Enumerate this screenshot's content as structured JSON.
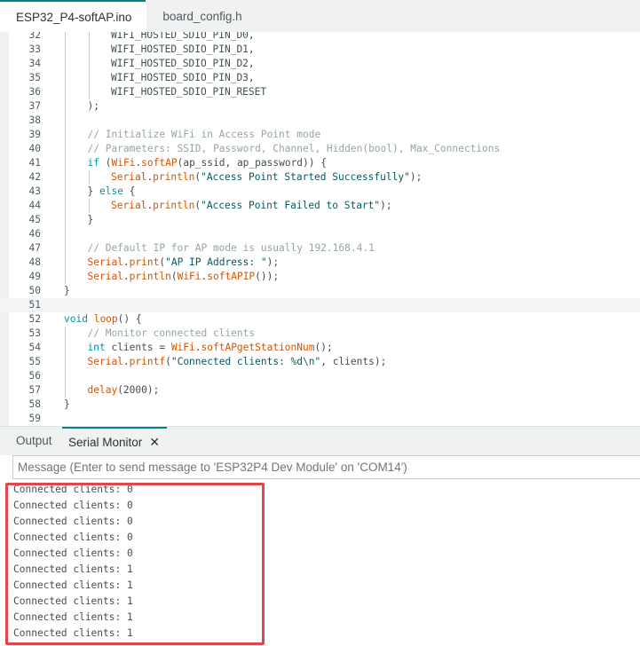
{
  "tabs": [
    {
      "label": "ESP32_P4-softAP.ino",
      "active": true
    },
    {
      "label": "board_config.h",
      "active": false
    }
  ],
  "editor": {
    "current_line": "51",
    "lines": [
      {
        "num": "32",
        "indent": 2,
        "parts": [
          [
            "",
            "WIFI_HOSTED_SDIO_PIN_D0,"
          ]
        ]
      },
      {
        "num": "33",
        "indent": 2,
        "parts": [
          [
            "",
            "WIFI_HOSTED_SDIO_PIN_D1,"
          ]
        ]
      },
      {
        "num": "34",
        "indent": 2,
        "parts": [
          [
            "",
            "WIFI_HOSTED_SDIO_PIN_D2,"
          ]
        ]
      },
      {
        "num": "35",
        "indent": 2,
        "parts": [
          [
            "",
            "WIFI_HOSTED_SDIO_PIN_D3,"
          ]
        ]
      },
      {
        "num": "36",
        "indent": 2,
        "parts": [
          [
            "",
            "WIFI_HOSTED_SDIO_PIN_RESET"
          ]
        ]
      },
      {
        "num": "37",
        "indent": 1,
        "parts": [
          [
            "",
            ");"
          ]
        ]
      },
      {
        "num": "38",
        "indent": 1,
        "parts": []
      },
      {
        "num": "39",
        "indent": 1,
        "parts": [
          [
            "cm",
            "// Initialize WiFi in Access Point mode"
          ]
        ]
      },
      {
        "num": "40",
        "indent": 1,
        "parts": [
          [
            "cm",
            "// Parameters: SSID, Password, Channel, Hidden(bool), Max_Connections"
          ]
        ]
      },
      {
        "num": "41",
        "indent": 1,
        "parts": [
          [
            "kw",
            "if"
          ],
          [
            "",
            " ("
          ],
          [
            "fn",
            "WiFi"
          ],
          [
            "",
            "."
          ],
          [
            "fn",
            "softAP"
          ],
          [
            "",
            "(ap_ssid, ap_password)) {"
          ]
        ]
      },
      {
        "num": "42",
        "indent": 2,
        "parts": [
          [
            "fn",
            "Serial"
          ],
          [
            "",
            "."
          ],
          [
            "fn",
            "println"
          ],
          [
            "",
            "("
          ],
          [
            "str",
            "\"Access Point Started Successfully\""
          ],
          [
            "",
            ");"
          ]
        ]
      },
      {
        "num": "43",
        "indent": 1,
        "parts": [
          [
            "",
            "} "
          ],
          [
            "kw",
            "else"
          ],
          [
            "",
            " {"
          ]
        ]
      },
      {
        "num": "44",
        "indent": 2,
        "parts": [
          [
            "fn",
            "Serial"
          ],
          [
            "",
            "."
          ],
          [
            "fn",
            "println"
          ],
          [
            "",
            "("
          ],
          [
            "str",
            "\"Access Point Failed to Start\""
          ],
          [
            "",
            ");"
          ]
        ]
      },
      {
        "num": "45",
        "indent": 1,
        "parts": [
          [
            "",
            "}"
          ]
        ]
      },
      {
        "num": "46",
        "indent": 1,
        "parts": []
      },
      {
        "num": "47",
        "indent": 1,
        "parts": [
          [
            "cm",
            "// Default IP for AP mode is usually 192.168.4.1"
          ]
        ]
      },
      {
        "num": "48",
        "indent": 1,
        "parts": [
          [
            "fn",
            "Serial"
          ],
          [
            "",
            "."
          ],
          [
            "fn",
            "print"
          ],
          [
            "",
            "("
          ],
          [
            "str",
            "\"AP IP Address: \""
          ],
          [
            "",
            ");"
          ]
        ]
      },
      {
        "num": "49",
        "indent": 1,
        "parts": [
          [
            "fn",
            "Serial"
          ],
          [
            "",
            "."
          ],
          [
            "fn",
            "println"
          ],
          [
            "",
            "("
          ],
          [
            "fn",
            "WiFi"
          ],
          [
            "",
            "."
          ],
          [
            "fn",
            "softAPIP"
          ],
          [
            "",
            "());"
          ]
        ]
      },
      {
        "num": "50",
        "indent": 0,
        "parts": [
          [
            "",
            "}"
          ]
        ]
      },
      {
        "num": "51",
        "indent": 0,
        "parts": []
      },
      {
        "num": "52",
        "indent": 0,
        "parts": [
          [
            "kw",
            "void"
          ],
          [
            "",
            " "
          ],
          [
            "fn",
            "loop"
          ],
          [
            "",
            "() {"
          ]
        ]
      },
      {
        "num": "53",
        "indent": 1,
        "parts": [
          [
            "cm",
            "// Monitor connected clients"
          ]
        ]
      },
      {
        "num": "54",
        "indent": 1,
        "parts": [
          [
            "kw",
            "int"
          ],
          [
            "",
            " clients = "
          ],
          [
            "fn",
            "WiFi"
          ],
          [
            "",
            "."
          ],
          [
            "fn",
            "softAPgetStationNum"
          ],
          [
            "",
            "();"
          ]
        ]
      },
      {
        "num": "55",
        "indent": 1,
        "parts": [
          [
            "fn",
            "Serial"
          ],
          [
            "",
            "."
          ],
          [
            "fn",
            "printf"
          ],
          [
            "",
            "("
          ],
          [
            "str",
            "\"Connected clients: %d\\n\""
          ],
          [
            "",
            ", clients);"
          ]
        ]
      },
      {
        "num": "56",
        "indent": 1,
        "parts": []
      },
      {
        "num": "57",
        "indent": 1,
        "parts": [
          [
            "fn",
            "delay"
          ],
          [
            "",
            "(2000);"
          ]
        ]
      },
      {
        "num": "58",
        "indent": 0,
        "parts": [
          [
            "",
            "}"
          ]
        ]
      },
      {
        "num": "59",
        "indent": 0,
        "parts": []
      }
    ]
  },
  "panel": {
    "output_tab": "Output",
    "serial_tab": "Serial Monitor",
    "message_placeholder": "Message (Enter to send message to 'ESP32P4 Dev Module' on 'COM14')",
    "lines": [
      "Connected clients: 0",
      "Connected clients: 0",
      "Connected clients: 0",
      "Connected clients: 0",
      "Connected clients: 0",
      "Connected clients: 1",
      "Connected clients: 1",
      "Connected clients: 1",
      "Connected clients: 1",
      "Connected clients: 1"
    ]
  },
  "colors": {
    "accent": "#008184",
    "highlight_box": "#e0464c",
    "keyword": "#00979c",
    "function": "#d35400",
    "comment": "#95a5a6",
    "string": "#005c5f"
  },
  "icons": {
    "close": "close-icon"
  }
}
